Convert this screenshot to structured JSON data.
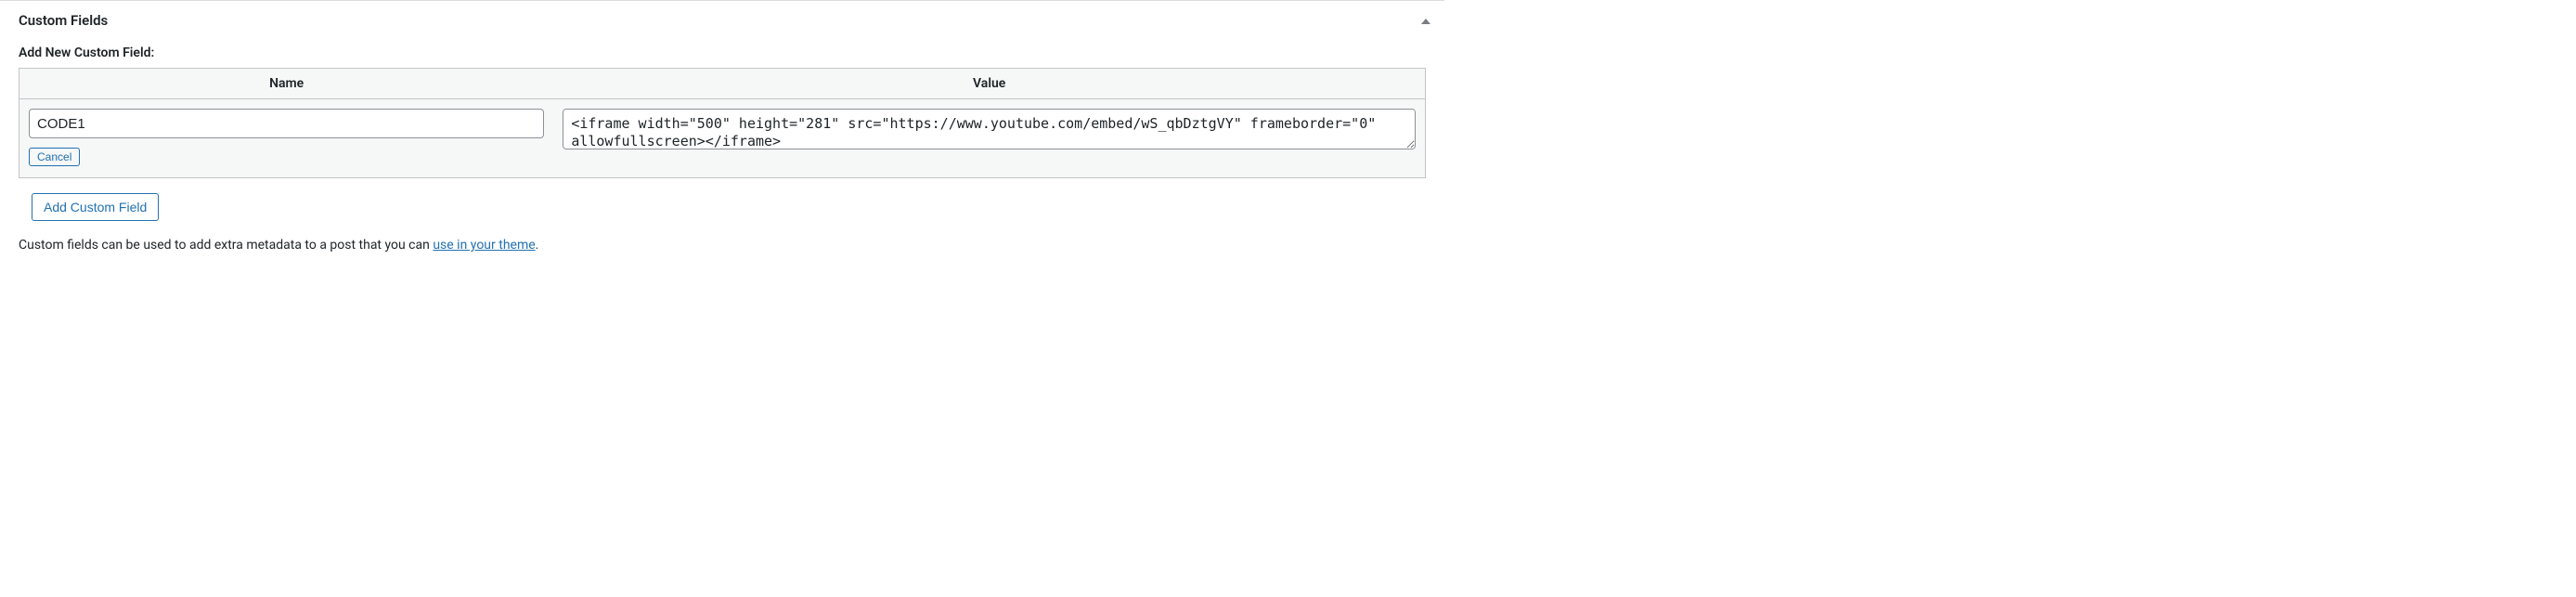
{
  "panel": {
    "title": "Custom Fields",
    "add_heading": "Add New Custom Field:",
    "columns": {
      "name": "Name",
      "value": "Value"
    },
    "fields": {
      "name_value": "CODE1",
      "value_value": "<iframe width=\"500\" height=\"281\" src=\"https://www.youtube.com/embed/wS_qbDztgVY\" frameborder=\"0\" allowfullscreen></iframe>"
    },
    "buttons": {
      "cancel": "Cancel",
      "add": "Add Custom Field"
    },
    "desc_prefix": "Custom fields can be used to add extra metadata to a post that you can ",
    "desc_link": "use in your theme",
    "desc_suffix": "."
  }
}
